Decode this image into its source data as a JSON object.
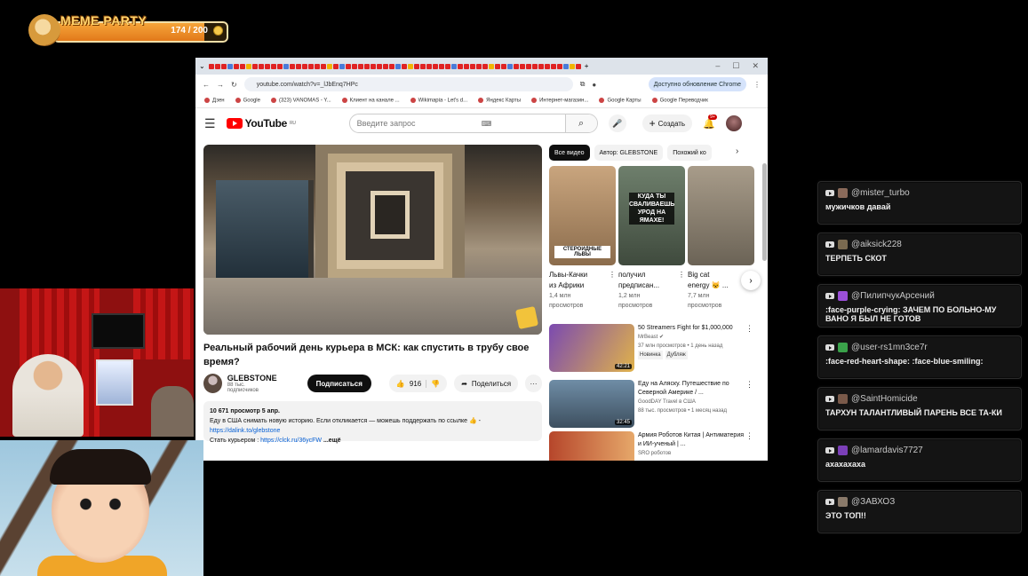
{
  "meme": {
    "title": "MEME PARTY",
    "count": "174 / 200",
    "progress": 0.87
  },
  "browser": {
    "url": "youtube.com/watch?v=_lJbEnq7HPc",
    "update_label": "Доступно обновление Chrome",
    "bookmarks": [
      "Дзен",
      "Google",
      "(323) VANOMAS - Y...",
      "Клиент на канале ...",
      "Wikimapia - Let's d...",
      "Яндекс Карты",
      "Интернет-магазин...",
      "Google Карты",
      "Google Переводчик"
    ]
  },
  "youtube": {
    "logo": "YouTube",
    "region": "RU",
    "search_placeholder": "Введите запрос",
    "create_label": "Создать",
    "notif_count": "9+",
    "video": {
      "title": "Реальный рабочий день курьера в МСК: как спустить в трубу свое время?",
      "channel": "GLEBSTONE",
      "subs": "88 тыс. подписчиков",
      "subscribe": "Подписаться",
      "likes": "916",
      "share": "Поделиться",
      "desc_meta": "10 671 просмотр  5 апр.",
      "desc_line1": "Еду в США снимать новую историю. Если откликается — можешь поддержать по ссылке 👍 -",
      "desc_link1": "https://dalink.to/glebstone",
      "desc_line3_prefix": "Стать курьером : ",
      "desc_link2": "https://clck.ru/36ycFW",
      "desc_more": "...ещё"
    },
    "chips": [
      "Все видео",
      "Автор: GLEBSTONE",
      "Похожий ко"
    ],
    "shorts": [
      {
        "caption": "СТЕРОИДНЫЕ ЛЬВЫ",
        "title": "Львы-Качки",
        "title2": "из Африки",
        "views": "1,4 млн",
        "views2": "просмотров",
        "bg": "#b79470"
      },
      {
        "caption": "КУДА ТЫ СВАЛИВАЕШЬ УРОД НА ЯМАХЕ!",
        "title": "получил",
        "title2": "предписан...",
        "views": "1,2 млн",
        "views2": "просмотров",
        "bg": "#5b6b59"
      },
      {
        "caption": "",
        "title": "Big cat",
        "title2": "energy 😺 ...",
        "views": "7,7 млн",
        "views2": "просмотров",
        "bg": "#8c8272"
      }
    ],
    "recs": [
      {
        "title": "50 Streamers Fight for $1,000,000",
        "channel": "MrBeast ✔",
        "meta": "37 млн просмотров • 1 день назад",
        "badge1": "Новинка",
        "badge2": "Дубляж",
        "duration": "42:21",
        "bg": "#7b4ab0"
      },
      {
        "title": "Еду на Аляску. Путешествие по Северной Америке / ...",
        "channel": "GoodDAY Travel в США",
        "meta": "88 тыс. просмотров • 1 месяц назад",
        "duration": "32:45",
        "bg": "#5e7a92"
      },
      {
        "title": "Армия Роботов Китая | Антиматерия и ИИ-ученый | ...",
        "channel": "SRO роботов",
        "meta": "",
        "duration": "",
        "bg": "#b6462b"
      }
    ]
  },
  "chat": [
    {
      "user": "@mister_turbo",
      "text": "мужичков давай",
      "avatar": "#8a6a5a"
    },
    {
      "user": "@aiksick228",
      "text": "ТЕРПЕТЬ СКОТ",
      "avatar": "#7a6a50"
    },
    {
      "user": "@ПилипчукАрсений",
      "text": ":face-purple-crying: ЗАЧЕМ ПО БОЛЬНО-МУ ВАНО Я БЫЛ НЕ ГОТОВ",
      "avatar": "#9b4fd8"
    },
    {
      "user": "@user-rs1mn3ce7r",
      "text": ":face-red-heart-shape: :face-blue-smiling:",
      "avatar": "#3aa24a"
    },
    {
      "user": "@SaintHomicide",
      "text": "ТАРХУН ТАЛАНТЛИВЫЙ ПАРЕНЬ ВСЕ ТА-КИ",
      "avatar": "#7a5a4a"
    },
    {
      "user": "@lamardavis7727",
      "text": "ахахахаха",
      "avatar": "#7b3fb8"
    },
    {
      "user": "@ЗАВХОЗ",
      "text": "ЭТО ТОП!!",
      "avatar": "#8a7a6a"
    }
  ]
}
